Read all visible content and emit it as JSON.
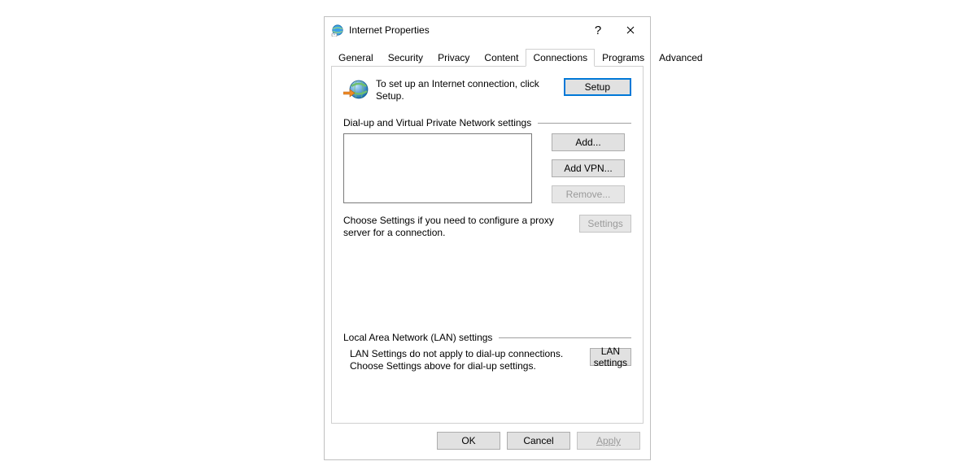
{
  "window": {
    "title": "Internet Properties",
    "help_label": "?",
    "close_label": "✕"
  },
  "tabs": {
    "general": "General",
    "security": "Security",
    "privacy": "Privacy",
    "content": "Content",
    "connections": "Connections",
    "programs": "Programs",
    "advanced": "Advanced"
  },
  "intro": {
    "text": "To set up an Internet connection, click Setup.",
    "setup_label": "Setup"
  },
  "dialup": {
    "header": "Dial-up and Virtual Private Network settings",
    "add_label": "Add...",
    "add_vpn_label": "Add VPN...",
    "remove_label": "Remove...",
    "settings_label": "Settings",
    "proxy_text": "Choose Settings if you need to configure a proxy server for a connection."
  },
  "lan": {
    "header": "Local Area Network (LAN) settings",
    "text": "LAN Settings do not apply to dial-up connections. Choose Settings above for dial-up settings.",
    "button_label": "LAN settings"
  },
  "footer": {
    "ok": "OK",
    "cancel": "Cancel",
    "apply": "Apply"
  }
}
